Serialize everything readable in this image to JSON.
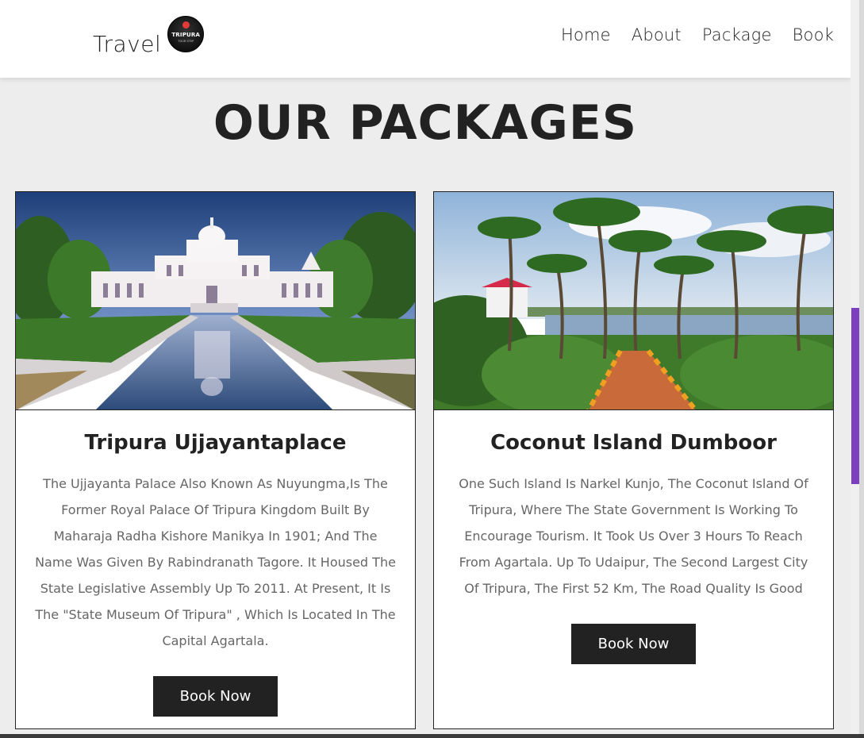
{
  "header": {
    "brand_text": "Travel",
    "logo_word": "TRIPURA",
    "logo_sub": "TOUR STEP",
    "nav": [
      "Home",
      "About",
      "Package",
      "Book"
    ]
  },
  "section": {
    "title": "OUR PACKAGES"
  },
  "packages": [
    {
      "title": "Tripura Ujjayantaplace",
      "description": "The Ujjayanta Palace Also Known As Nuyungma,Is The Former Royal Palace Of Tripura Kingdom Built By Maharaja Radha Kishore Manikya In 1901; And The Name Was Given By Rabindranath Tagore. It Housed The State Legislative Assembly Up To 2011. At Present, It Is The \"State Museum Of Tripura\" , Which Is Located In The Capital Agartala.",
      "button": "Book Now"
    },
    {
      "title": "Coconut Island Dumboor",
      "description": "One Such Island Is Narkel Kunjo, The Coconut Island Of Tripura, Where The State Government Is Working To Encourage Tourism. It Took Us Over 3 Hours To Reach From Agartala. Up To Udaipur, The Second Largest City Of Tripura, The First 52 Km, The Road Quality Is Good",
      "button": "Book Now"
    }
  ],
  "colors": {
    "accent": "#222222",
    "background": "#ededed",
    "scroll_accent": "#7b3fbf"
  }
}
